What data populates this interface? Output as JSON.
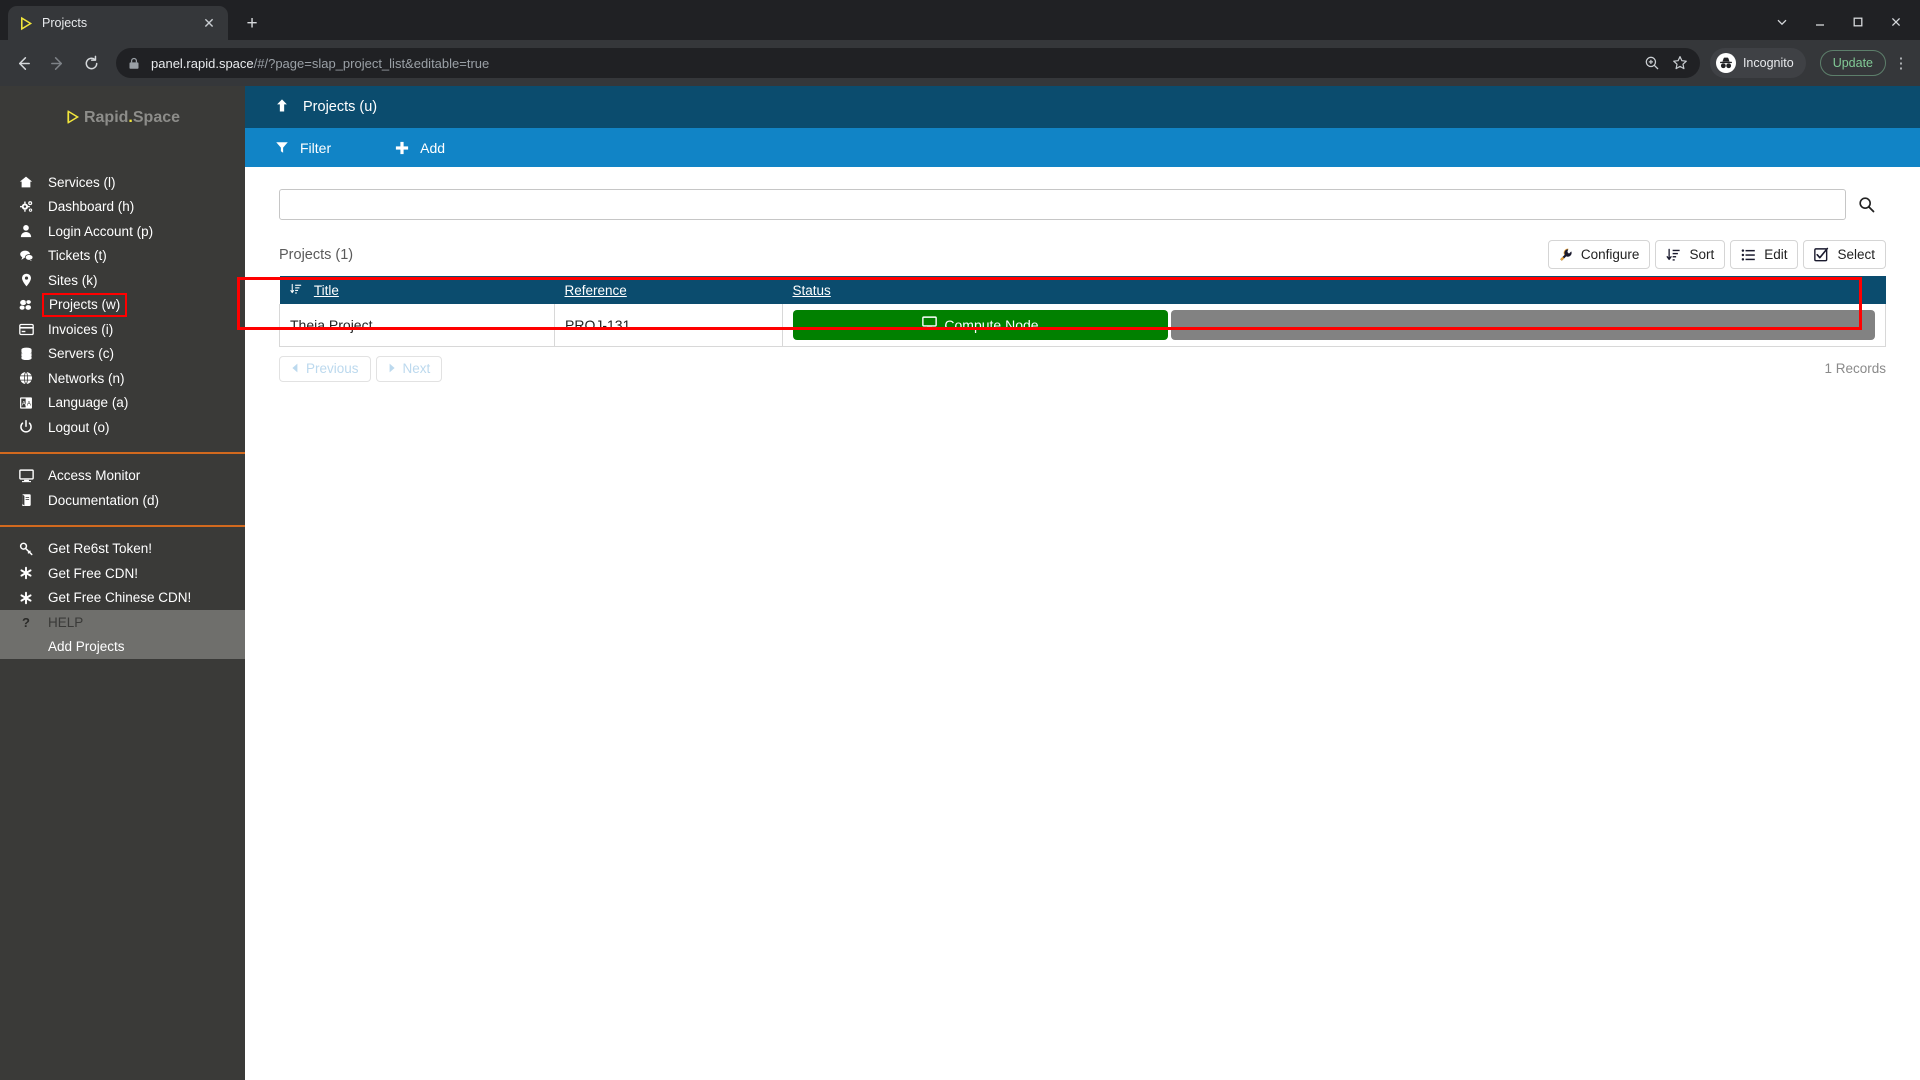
{
  "browser": {
    "tab": {
      "title": "Projects",
      "favicon_icon": "rapidspace-play-icon",
      "close_icon": "close-icon"
    },
    "new_tab_icon": "plus-icon",
    "window_controls": {
      "chevron_icon": "chevron-down-icon",
      "minimize_icon": "minimize-icon",
      "maximize_icon": "maximize-icon",
      "close_icon": "window-close-icon"
    },
    "nav": {
      "back_icon": "arrow-back-icon",
      "forward_icon": "arrow-forward-icon",
      "reload_icon": "reload-icon"
    },
    "omnibox": {
      "lock_icon": "lock-icon",
      "url_host": "panel.rapid.space",
      "url_path": "/#/?page=slap_project_list&editable=true",
      "zoom_icon": "zoom-in-icon",
      "bookmark_icon": "star-icon"
    },
    "incognito": {
      "label": "Incognito",
      "icon": "incognito-icon"
    },
    "update_button": "Update",
    "menu_icon": "kebab-menu-icon"
  },
  "sidebar": {
    "brand": {
      "mark": "▷",
      "rapid": "Rapid",
      "dot": ".",
      "space": "Space"
    },
    "primary_items": [
      {
        "label": "Services (l)",
        "icon": "home-icon"
      },
      {
        "label": "Dashboard (h)",
        "icon": "gears-icon"
      },
      {
        "label": "Login Account (p)",
        "icon": "user-icon"
      },
      {
        "label": "Tickets (t)",
        "icon": "comments-icon"
      },
      {
        "label": "Sites (k)",
        "icon": "map-marker-icon"
      },
      {
        "label": "Projects (w)",
        "icon": "cubes-icon",
        "highlighted": true
      },
      {
        "label": "Invoices (i)",
        "icon": "credit-card-icon"
      },
      {
        "label": "Servers (c)",
        "icon": "database-icon"
      },
      {
        "label": "Networks (n)",
        "icon": "globe-icon"
      },
      {
        "label": "Language (a)",
        "icon": "language-icon"
      },
      {
        "label": "Logout (o)",
        "icon": "power-off-icon"
      }
    ],
    "secondary_items": [
      {
        "label": "Access Monitor",
        "icon": "desktop-icon"
      },
      {
        "label": "Documentation (d)",
        "icon": "book-icon"
      }
    ],
    "tertiary_items": [
      {
        "label": "Get Re6st Token!",
        "icon": "key-icon"
      },
      {
        "label": "Get Free CDN!",
        "icon": "asterisk-icon"
      },
      {
        "label": "Get Free Chinese CDN!",
        "icon": "asterisk-icon"
      }
    ],
    "help_items": [
      {
        "label": "HELP",
        "icon": "question-mark-icon"
      },
      {
        "label": "Add Projects",
        "icon": ""
      }
    ]
  },
  "app": {
    "header": {
      "up_icon": "arrow-up-icon",
      "title": "Projects (u)"
    },
    "toolbar": {
      "filter": {
        "label": "Filter",
        "icon": "filter-icon"
      },
      "add": {
        "label": "Add",
        "icon": "plus-icon"
      }
    },
    "search": {
      "value": "",
      "placeholder": "",
      "button_icon": "search-icon"
    },
    "list_title": "Projects (1)",
    "actions": [
      {
        "label": "Configure",
        "icon": "wrench-icon"
      },
      {
        "label": "Sort",
        "icon": "sort-amount-down-icon"
      },
      {
        "label": "Edit",
        "icon": "list-icon"
      },
      {
        "label": "Select",
        "icon": "check-square-icon"
      }
    ],
    "table": {
      "columns": [
        {
          "label": "Title",
          "sort_icon": "sort-asc-icon"
        },
        {
          "label": "Reference",
          "sort_icon": ""
        },
        {
          "label": "Status",
          "sort_icon": ""
        }
      ],
      "rows": [
        {
          "title": "Theia Project",
          "reference": "PROJ-131",
          "status_badge": {
            "label": "Compute Node",
            "icon": "desktop-icon",
            "color": "#018000"
          },
          "status_bar_color": "#828282"
        }
      ]
    },
    "pagination": {
      "previous": {
        "label": "Previous",
        "icon": "caret-left-icon",
        "disabled": true
      },
      "next": {
        "label": "Next",
        "icon": "caret-right-icon",
        "disabled": true
      }
    },
    "records": "1 Records"
  },
  "annotations": {
    "highlight_color": "#ff0000"
  }
}
